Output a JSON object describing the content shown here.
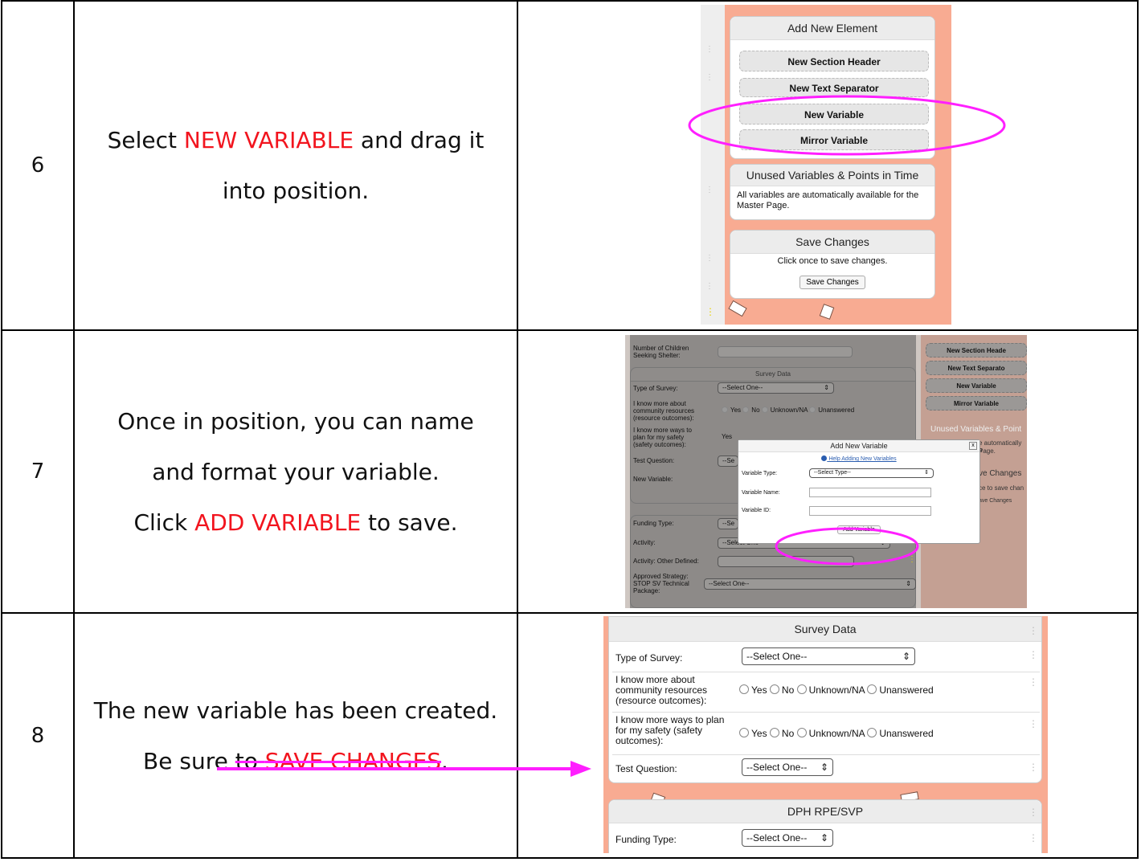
{
  "rows": [
    {
      "num": "6",
      "desc": {
        "pre": "Select ",
        "hl": "NEW VARIABLE",
        "post": " and drag it into position."
      }
    },
    {
      "num": "7",
      "desc": {
        "l1": "Once in position, you can name",
        "l2": "and format your variable.",
        "l3_pre": "Click ",
        "l3_hl": "ADD VARIABLE",
        "l3_post": " to save."
      }
    },
    {
      "num": "8",
      "desc": {
        "l1": "The new variable has been created.",
        "l2_pre": "Be sure ",
        "l2_strike": "to ",
        "l2_hl": "SAVE CHANGES",
        "l2_post": "."
      }
    }
  ],
  "shot6": {
    "add_header": "Add New Element",
    "btn_section": "New Section Header",
    "btn_text": "New Text Separator",
    "btn_variable": "New Variable",
    "btn_mirror": "Mirror Variable",
    "unused_header": "Unused Variables & Points in Time",
    "unused_body": "All variables are automatically available for the Master Page.",
    "save_header": "Save Changes",
    "save_body": "Click once to save changes.",
    "save_button": "Save Changes"
  },
  "shot7": {
    "children_label": "Number of Children Seeking Shelter:",
    "survey_header": "Survey Data",
    "type_label": "Type of Survey:",
    "select_one": "--Select One--",
    "know_resources": "I know more about community resources (resource outcomes):",
    "opt_yes": "Yes",
    "opt_no": "No",
    "opt_unknown": "Unknown/NA",
    "opt_unanswered": "Unanswered",
    "know_safety": "I know more ways to plan for my safety (safety outcomes):",
    "yes_cut": "Yes",
    "test_label": "Test Question:",
    "se_cut": "--Se",
    "new_var_label": "New Variable:",
    "funding_label": "Funding Type:",
    "activity_label": "Activity:",
    "activity_other": "Activity: Other Defined:",
    "approved_label": "Approved Strategy: STOP SV Technical Package:",
    "r_section": "New Section Heade",
    "r_text": "New Text Separato",
    "r_variable": "New Variable",
    "r_mirror": "Mirror Variable",
    "r_unused": "Unused Variables & Point",
    "r_auto": "e automatically a",
    "r_page": "Page.",
    "r_save_hdr": "ve Changes",
    "r_save_txt": "ce to save chan",
    "r_save_btn": "ave Changes",
    "modal_title": "Add New Variable",
    "modal_close": "x",
    "modal_help": "Help Adding New Variables",
    "type_field": "Variable Type:",
    "type_value": "--Select Type--",
    "name_field": "Variable Name:",
    "id_field": "Variable ID:",
    "add_button": "Add Variable"
  },
  "shot8": {
    "survey_header": "Survey Data",
    "type_label": "Type of Survey:",
    "select_one": "--Select One--",
    "q1": "I know more about community resources (resource outcomes):",
    "q2": "I know more ways to plan for my safety (safety outcomes):",
    "opt_yes": "Yes",
    "opt_no": "No",
    "opt_unknown": "Unknown/NA",
    "opt_unanswered": "Unanswered",
    "test_label": "Test Question:",
    "dph_header": "DPH RPE/SVP",
    "funding_label": "Funding Type:"
  },
  "colors": {
    "highlight_text": "#f2141e",
    "annotation_magenta": "#ff1fff",
    "background_salmon": "#f8ab92"
  }
}
